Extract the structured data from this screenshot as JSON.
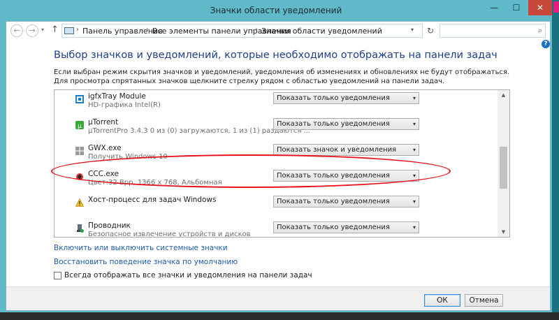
{
  "window": {
    "title": "Значки области уведомлений",
    "minimize": "—",
    "maximize": "☐",
    "close": "✕"
  },
  "nav": {
    "back": "←",
    "forward": "→",
    "history": "▾",
    "up": "↑",
    "breadcrumb": [
      "Панель управления",
      "Все элементы панели управления",
      "Значки области уведомлений"
    ],
    "separator": "›",
    "address_dropdown": "▾",
    "refresh": "↻",
    "search_placeholder": "",
    "search_icon": "⌕"
  },
  "help": "?",
  "heading": "Выбор значков и уведомлений, которые необходимо отображать на панели задач",
  "description": "Если выбран режим скрытия значков и уведомлений, уведомления об изменениях и обновлениях не будут отображаться. Для просмотра спрятанных значков щелкните стрелку рядом с областью уведомлений на панели задач.",
  "apps": [
    {
      "name": "igfxTray Module",
      "sub": "HD-графика Intel(R)",
      "behavior": "Показать только уведомления",
      "icon": "intel-graphics-icon"
    },
    {
      "name": "µTorrent",
      "sub": "µTorrentPro 3.4.3   0 из (0) загружаются, 1 из (1) раздаются   ...",
      "behavior": "Показать только уведомления",
      "icon": "utorrent-icon"
    },
    {
      "name": "GWX.exe",
      "sub": "Получить Windows 10",
      "behavior": "Показать значок и уведомления",
      "icon": "windows-logo-icon"
    },
    {
      "name": "CCC.exe",
      "sub": "Цвет:32 Bpp, 1366 x 768, Альбомная",
      "behavior": "Показать только уведомления",
      "icon": "catalyst-icon"
    },
    {
      "name": "Хост-процесс для задач Windows",
      "sub": "",
      "behavior": "Показать только уведомления",
      "icon": "warning-icon"
    },
    {
      "name": "Проводник",
      "sub": "Безопасное извлечение устройств и дисков",
      "behavior": "Показать только уведомления",
      "icon": "safely-remove-icon"
    }
  ],
  "dropdown_arrow": "▾",
  "scroll": {
    "up": "▲",
    "down": "▼"
  },
  "links": {
    "system_icons": "Включить или выключить системные значки",
    "restore_default": "Восстановить поведение значка по умолчанию"
  },
  "always_show_label": "Всегда отображать все значки и уведомления на панели задач",
  "buttons": {
    "ok": "ОК",
    "cancel": "Отмена"
  },
  "colors": {
    "accent": "#1e5aa8",
    "annotation": "#e3121b",
    "titlebar": "#5fb9c9"
  }
}
